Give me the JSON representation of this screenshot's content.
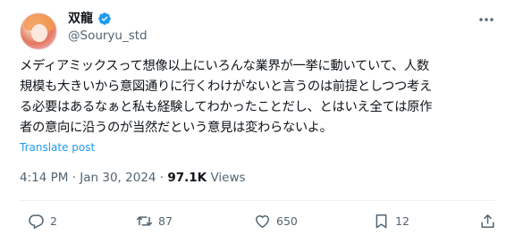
{
  "author": {
    "display_name": "双龍",
    "handle": "@Souryu_std",
    "verified": true
  },
  "tweet": {
    "lines": [
      "メディアミックスって想像以上にいろんな業界が一挙に動いていて、人数",
      "規模も大きいから意図通りに行くわけがないと言うのは前提としつつ考え",
      "る必要はあるなぁと私も経験してわかったことだし、とはいえ全ては原作",
      "者の意向に沿うのが当然だという意見は変わらないよ。"
    ],
    "translate_label": "Translate post"
  },
  "meta": {
    "time": "4:14 PM",
    "separator": " · ",
    "date": "Jan 30, 2024",
    "views_count": "97.1K",
    "views_label": "Views"
  },
  "actions": {
    "replies": "2",
    "retweets": "87",
    "likes": "650",
    "bookmarks": "12"
  },
  "colors": {
    "accent": "#1d9bf0",
    "secondary_text": "#536471",
    "divider": "#eff3f4"
  }
}
